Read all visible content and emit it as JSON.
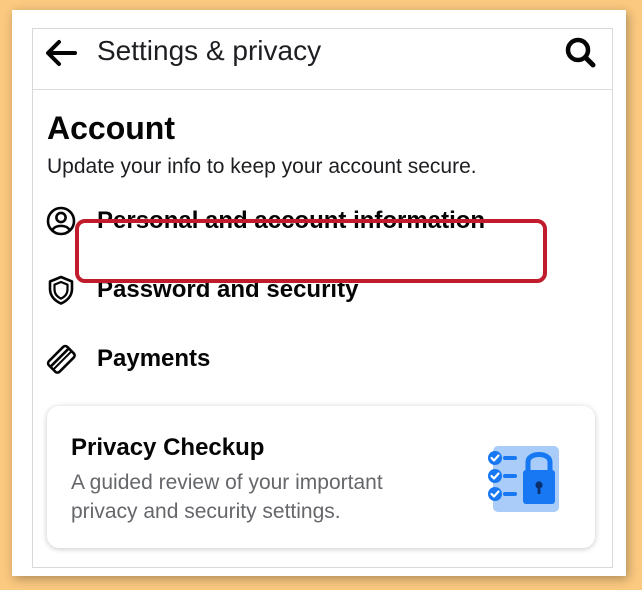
{
  "header": {
    "title": "Settings & privacy",
    "back_icon": "arrow-left-icon",
    "search_icon": "search-icon"
  },
  "account": {
    "heading": "Account",
    "description": "Update your info to keep your account secure.",
    "items": [
      {
        "label": "Personal and account information",
        "icon": "user-circle-icon",
        "highlighted": true
      },
      {
        "label": "Password and security",
        "icon": "shield-icon",
        "highlighted": false
      },
      {
        "label": "Payments",
        "icon": "credit-card-icon",
        "highlighted": false
      }
    ]
  },
  "privacy_checkup": {
    "title": "Privacy Checkup",
    "description": "A guided review of your important privacy and security settings.",
    "illustration": "checklist-lock-icon"
  },
  "colors": {
    "background": "#fbc97f",
    "highlight": "#c01c2c",
    "accent_blue": "#1877f2",
    "text_secondary": "#65676b"
  }
}
